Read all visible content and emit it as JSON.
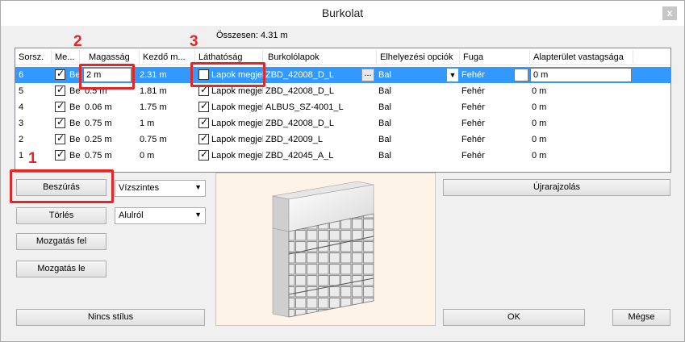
{
  "window": {
    "title": "Burkolat",
    "close_label": "x"
  },
  "summary": {
    "text": "Összesen: 4.31 m"
  },
  "columns": [
    "Sorsz.",
    "Me...",
    "Magasság",
    "Kezdő m...",
    "Láthatóság",
    "Burkolólapok",
    "Elhelyezési opciók",
    "Fuga",
    "Alapterület vastagsága"
  ],
  "rows": [
    {
      "sorsz": "6",
      "me": "Be",
      "me_checked": true,
      "magassag": "2 m",
      "kezdo": "2.31 m",
      "lathatosag": "Lapok megjel",
      "lath_checked": false,
      "burkolo": "ZBD_42008_D_L",
      "elhelyezes": "Bal",
      "fuga": "Fehér",
      "vastagsag": "0 m",
      "selected": true
    },
    {
      "sorsz": "5",
      "me": "Be",
      "me_checked": true,
      "magassag": "0.5 m",
      "kezdo": "1.81 m",
      "lathatosag": "Lapok megjel",
      "lath_checked": true,
      "burkolo": "ZBD_42008_D_L",
      "elhelyezes": "Bal",
      "fuga": "Fehér",
      "vastagsag": "0 m",
      "selected": false
    },
    {
      "sorsz": "4",
      "me": "Be",
      "me_checked": true,
      "magassag": "0.06 m",
      "kezdo": "1.75 m",
      "lathatosag": "Lapok megjel",
      "lath_checked": true,
      "burkolo": "ALBUS_SZ-4001_L",
      "elhelyezes": "Bal",
      "fuga": "Fehér",
      "vastagsag": "0 m",
      "selected": false
    },
    {
      "sorsz": "3",
      "me": "Be",
      "me_checked": true,
      "magassag": "0.75 m",
      "kezdo": "1 m",
      "lathatosag": "Lapok megjel",
      "lath_checked": true,
      "burkolo": "ZBD_42008_D_L",
      "elhelyezes": "Bal",
      "fuga": "Fehér",
      "vastagsag": "0 m",
      "selected": false
    },
    {
      "sorsz": "2",
      "me": "Be",
      "me_checked": true,
      "magassag": "0.25 m",
      "kezdo": "0.75 m",
      "lathatosag": "Lapok megjel",
      "lath_checked": true,
      "burkolo": "ZBD_42009_L",
      "elhelyezes": "Bal",
      "fuga": "Fehér",
      "vastagsag": "0 m",
      "selected": false
    },
    {
      "sorsz": "1",
      "me": "Be",
      "me_checked": true,
      "magassag": "0.75 m",
      "kezdo": "0 m",
      "lathatosag": "Lapok megjel",
      "lath_checked": true,
      "burkolo": "ZBD_42045_A_L",
      "elhelyezes": "Bal",
      "fuga": "Fehér",
      "vastagsag": "0 m",
      "selected": false
    }
  ],
  "buttons": {
    "beszuras": "Beszúrás",
    "torles": "Törlés",
    "mozgatas_fel": "Mozgatás fel",
    "mozgatas_le": "Mozgatás le",
    "nincs_stilus": "Nincs stílus",
    "ujrarajzolas": "Újrarajzolás",
    "ok": "OK",
    "megse": "Mégse"
  },
  "selects": {
    "orientation": "Vízszintes",
    "direction": "Alulról"
  },
  "annotations": [
    "1",
    "2",
    "3"
  ],
  "colors": {
    "highlight": "#3399ff",
    "marker": "#e02828"
  }
}
